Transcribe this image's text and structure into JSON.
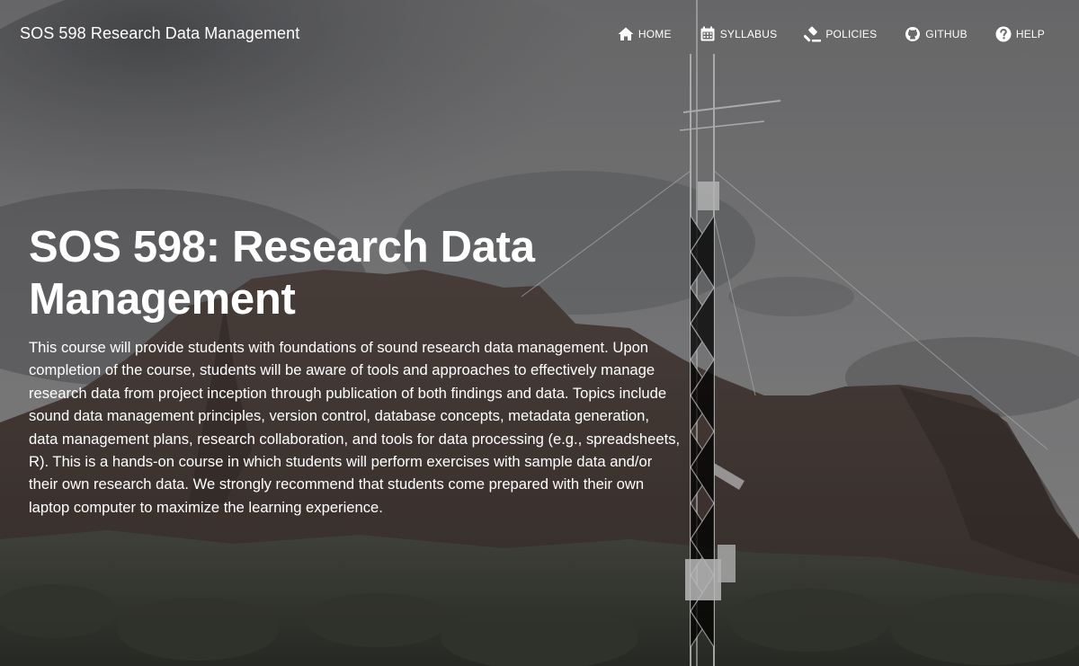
{
  "navbar": {
    "brand": "SOS 598 Research Data Management",
    "items": [
      {
        "label": "HOME",
        "icon": "home-icon"
      },
      {
        "label": "SYLLABUS",
        "icon": "calendar-icon"
      },
      {
        "label": "POLICIES",
        "icon": "gavel-icon"
      },
      {
        "label": "GITHUB",
        "icon": "github-icon"
      },
      {
        "label": "HELP",
        "icon": "question-circle-icon"
      }
    ]
  },
  "hero": {
    "title": "SOS 598: Research Data Management",
    "description": "This course will provide students with foundations of sound research data management. Upon completion of the course, students will be aware of tools and approaches to effectively manage research data from project inception through publication of both findings and data. Topics include sound data management principles, version control, database concepts, metadata generation, data management plans, research collaboration, and tools for data processing (e.g., spreadsheets, R). This is a hands-on course in which students will perform exercises with sample data and/or their own research data. We strongly recommend that students come prepared with their own laptop computer to maximize the learning experience.",
    "background_image": "desert-mountain-weather-tower-photo"
  },
  "colors": {
    "text": "#ffffff",
    "sky": "#8a8a8c",
    "mountain": "#4a3e3a",
    "vegetation": "#3e4236"
  }
}
